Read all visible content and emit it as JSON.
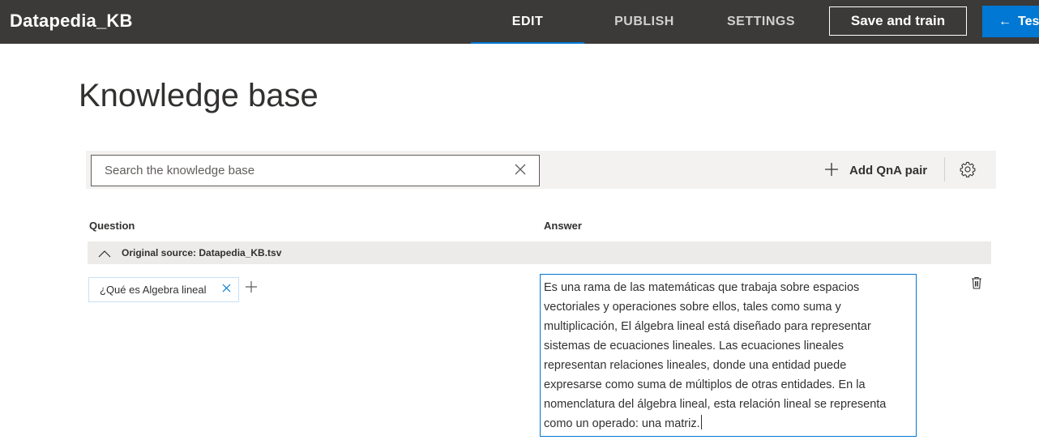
{
  "header": {
    "app_title": "Datapedia_KB",
    "tabs": [
      {
        "label": "EDIT",
        "active": true
      },
      {
        "label": "PUBLISH",
        "active": false
      },
      {
        "label": "SETTINGS",
        "active": false
      }
    ],
    "save_label": "Save and train",
    "test_label": "Test",
    "test_icon": "arrow-left-icon"
  },
  "page": {
    "title": "Knowledge base"
  },
  "toolbar": {
    "search_placeholder": "Search the knowledge base",
    "search_value": "",
    "add_label": "Add QnA pair"
  },
  "columns": {
    "question": "Question",
    "answer": "Answer"
  },
  "group": {
    "label": "Original source: Datapedia_KB.tsv",
    "expanded": true
  },
  "qna": [
    {
      "question": "¿Qué es Algebra lineal",
      "answer_lines": [
        "Es una rama de las matemáticas que trabaja sobre espacios",
        "vectoriales y operaciones sobre ellos, tales como suma y",
        "multiplicación, El álgebra lineal está diseñado para representar",
        "sistemas de ecuaciones lineales. Las ecuaciones lineales",
        "representan relaciones lineales, donde una entidad puede",
        "expresarse como suma de múltiplos de otras entidades. En la",
        "nomenclatura del álgebra lineal, esta relación lineal se representa",
        "como un operado: una matriz."
      ]
    }
  ],
  "colors": {
    "topbar": "#3b3a39",
    "accent": "#0078d4",
    "toolbar_bg": "#f3f2f1",
    "group_bg": "#edebe9"
  }
}
